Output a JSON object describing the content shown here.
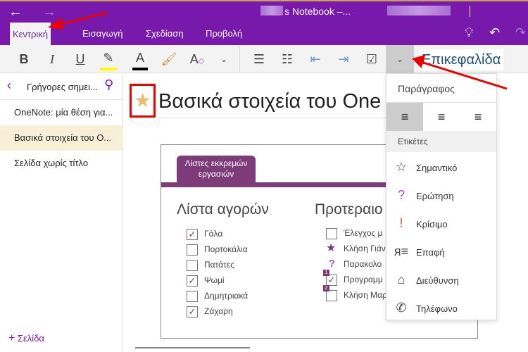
{
  "window": {
    "title": "s Notebook –..."
  },
  "tabs": [
    "Κεντρική",
    "Εισαγωγή",
    "Σχεδίαση",
    "Προβολή"
  ],
  "toolbar": {
    "style_value": "Επικεφαλίδα"
  },
  "sidebar": {
    "section": "Γρήγορες σημει...",
    "pages": [
      "OneNote: μία θέση για...",
      "Βασικά στοιχεία του O...",
      "Σελίδα χωρίς τίτλο"
    ],
    "add_page": "Σελίδα"
  },
  "page": {
    "title": "Βασικά στοιχεία του One",
    "card": {
      "tab": "Λίστες εκκρεμών εργασιών",
      "left_heading": "Λίστα αγορών",
      "right_heading": "Προτεραιο",
      "shopping": [
        {
          "text": "Γάλα",
          "checked": true
        },
        {
          "text": "Πορτοκάλια",
          "checked": false
        },
        {
          "text": "Πατάτες",
          "checked": false
        },
        {
          "text": "Ψωμί",
          "checked": true
        },
        {
          "text": "Δημητριακά",
          "checked": false
        },
        {
          "text": "Ζάχαρη",
          "checked": true
        }
      ],
      "priority": [
        {
          "text": "Έλεγχος μ",
          "tag": "checkbox"
        },
        {
          "text": "Κλήση Γιάν",
          "tag": "star"
        },
        {
          "text": "Παρακολο",
          "tag": "question"
        },
        {
          "text": "Προγραμμ",
          "tag": "checked",
          "num": "1"
        },
        {
          "text": "Κλήση Μαρ",
          "tag": "checkbox",
          "num": "2"
        }
      ]
    }
  },
  "dropdown": {
    "paragraph": "Παράγραφος",
    "tags_header": "Ετικέτες",
    "tags": [
      {
        "label": "Σημαντικό",
        "icon": "star-outline-icon",
        "color": "#444444"
      },
      {
        "label": "Ερώτηση",
        "icon": "question-icon",
        "color": "#a050c8"
      },
      {
        "label": "Κρίσιμο",
        "icon": "exclamation-icon",
        "color": "#d9534f"
      },
      {
        "label": "Επαφή",
        "icon": "contact-icon",
        "color": "#444444"
      },
      {
        "label": "Διεύθυνση",
        "icon": "home-icon",
        "color": "#444444"
      },
      {
        "label": "Τηλέφωνο",
        "icon": "phone-icon",
        "color": "#444444"
      }
    ]
  }
}
